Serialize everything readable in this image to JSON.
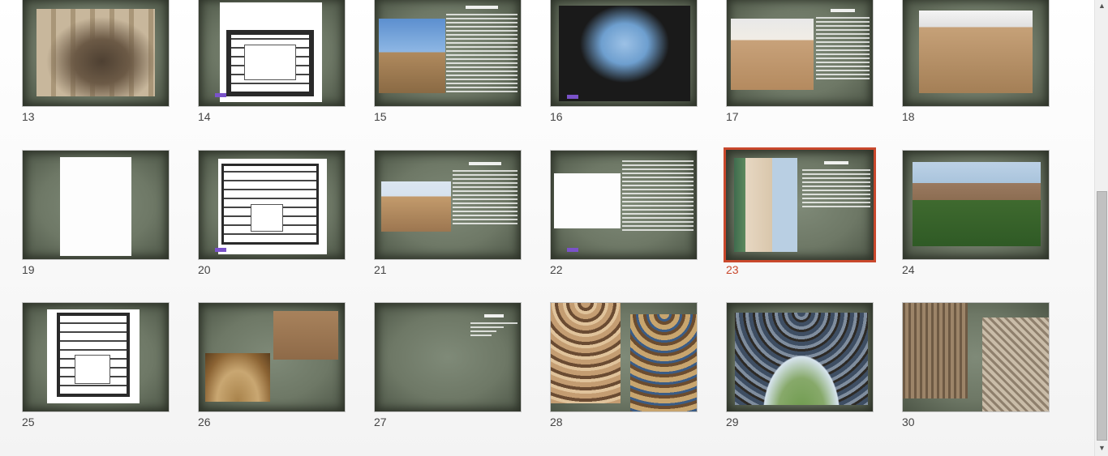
{
  "app": {
    "view": "Slide Sorter"
  },
  "slides": [
    {
      "number": "13"
    },
    {
      "number": "14"
    },
    {
      "number": "15"
    },
    {
      "number": "16"
    },
    {
      "number": "17"
    },
    {
      "number": "18"
    },
    {
      "number": "19"
    },
    {
      "number": "20"
    },
    {
      "number": "21"
    },
    {
      "number": "22"
    },
    {
      "number": "23"
    },
    {
      "number": "24"
    },
    {
      "number": "25"
    },
    {
      "number": "26"
    },
    {
      "number": "27"
    },
    {
      "number": "28"
    },
    {
      "number": "29"
    },
    {
      "number": "30"
    }
  ],
  "selected_slide": "23",
  "colors": {
    "selection": "#c9482c",
    "slide_bg": "#6e7866",
    "hyperlink": "#7a52c9"
  },
  "scrollbar": {
    "up_icon": "arrow-up-icon",
    "down_icon": "arrow-down-icon",
    "position": 0.85
  }
}
